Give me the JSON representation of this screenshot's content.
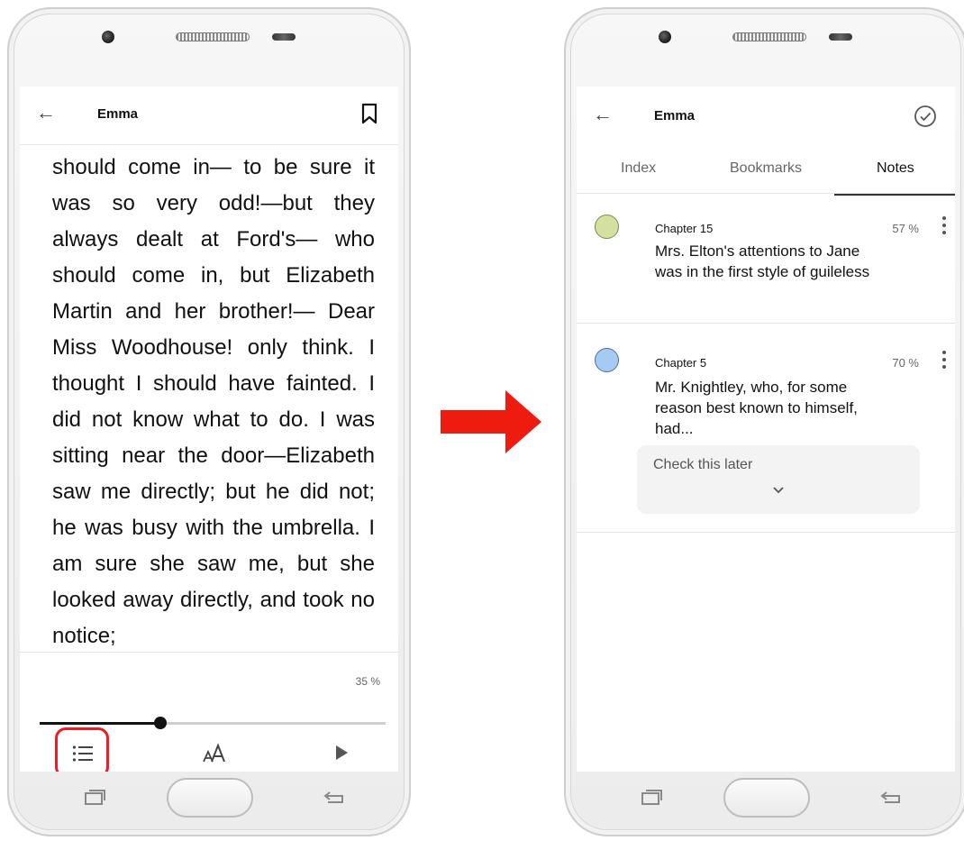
{
  "left_phone": {
    "book_title": "Emma",
    "text": "should come in— to be sure it was so very odd!—but they always dealt at Ford's— who should come in, but Elizabeth Martin and her brother!— Dear Miss Woodhouse! only think. I thought I should have fainted. I did not know what to do. I was sitting near the door—Elizabeth saw me directly; but he did not; he was busy with the umbrella. I am sure she saw me, but she looked away directly, and took no notice;",
    "progress_label": "35 %",
    "progress_fraction": 0.35,
    "bottom_icons": [
      "list-icon",
      "font-size-icon",
      "play-icon"
    ],
    "highlight_color": "#ee1c24"
  },
  "arrow_color": "#ee1c0f",
  "right_phone": {
    "book_title": "Emma",
    "tabs": [
      {
        "label": "Index"
      },
      {
        "label": "Bookmarks"
      },
      {
        "label": "Notes"
      }
    ],
    "active_tab": "Notes",
    "notes": [
      {
        "chapter": "Chapter 15",
        "percent": "57 %",
        "text": "Mrs. Elton's attentions to Jane was in the first style of guileless",
        "color": "#d3e0a0"
      },
      {
        "chapter": "Chapter 5",
        "percent": "70 %",
        "text": "Mr. Knightley, who, for some reason best known to himself, had...",
        "color": "#a6cbf2",
        "comment": "Check this later"
      }
    ]
  }
}
